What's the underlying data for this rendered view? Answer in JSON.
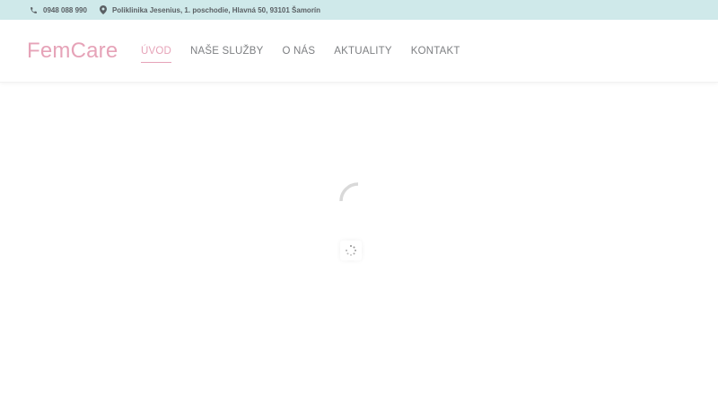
{
  "topbar": {
    "phone": "0948 088 990",
    "address": "Poliklinika Jesenius, 1. poschodie, Hlavná 50, 93101 Šamorín",
    "background_color": "#cfe9ea",
    "phone_icon": "phone-icon",
    "address_icon": "map-pin-icon"
  },
  "header": {
    "logo": "FemCare",
    "brand_color": "#e6a3b8",
    "nav": [
      {
        "label": "ÚVOD",
        "active": true
      },
      {
        "label": "NAŠE SLUŽBY",
        "active": false
      },
      {
        "label": "O NÁS",
        "active": false
      },
      {
        "label": "AKTUALITY",
        "active": false
      },
      {
        "label": "KONTAKT",
        "active": false
      }
    ]
  },
  "main": {
    "spinner_icon": "loading-spinner-icon",
    "loader_icon": "loading-dots-icon"
  }
}
